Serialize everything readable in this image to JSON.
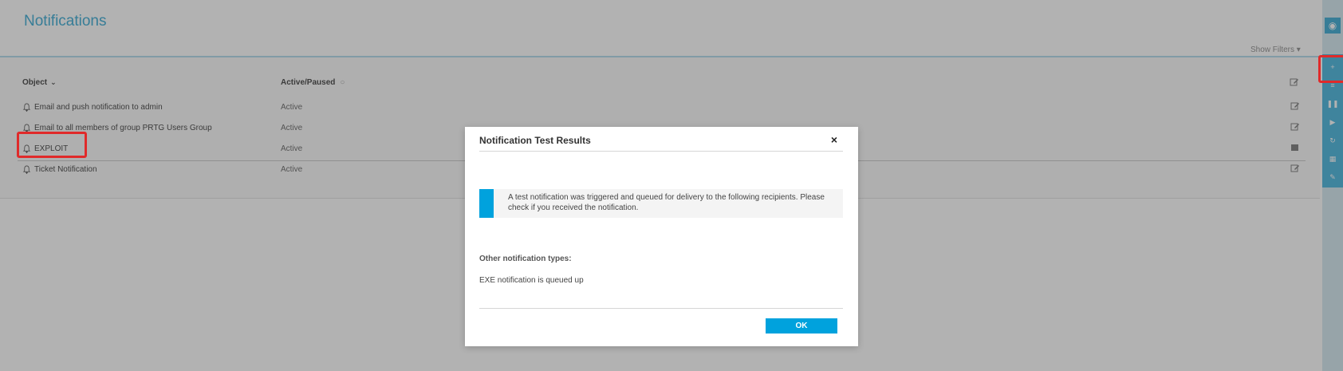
{
  "page": {
    "title": "Notifications",
    "show_filters": "Show Filters ▾"
  },
  "table": {
    "columns": [
      "Object",
      "Active/Paused"
    ],
    "sort_indicator": "⌄",
    "rows": [
      {
        "name": "Email and push notification to admin",
        "status": "Active"
      },
      {
        "name": "Email to all members of group PRTG Users Group",
        "status": "Active"
      },
      {
        "name": "EXPLOIT",
        "status": "Active"
      },
      {
        "name": "Ticket Notification",
        "status": "Active"
      }
    ]
  },
  "dialog": {
    "title": "Notification Test Results",
    "close": "×",
    "message": "A test notification was triggered and queued for delivery to the following recipients. Please check if you received the notification.",
    "other_label": "Other notification types:",
    "other_value": "EXE notification is queued up",
    "ok_label": "OK"
  },
  "colors": {
    "accent": "#00a2dd",
    "title": "#4fb3d8",
    "highlight": "#e02a2a",
    "overlay": "rgba(0,0,0,0.30)"
  },
  "icons": {
    "row_icon": "bell-icon",
    "edit_icon": "edit-icon",
    "close_icon": "close-icon",
    "rail_icons": [
      "add-icon",
      "list-icon",
      "pause-icon",
      "play-icon",
      "refresh-icon",
      "grid-icon",
      "wrench-icon"
    ]
  }
}
